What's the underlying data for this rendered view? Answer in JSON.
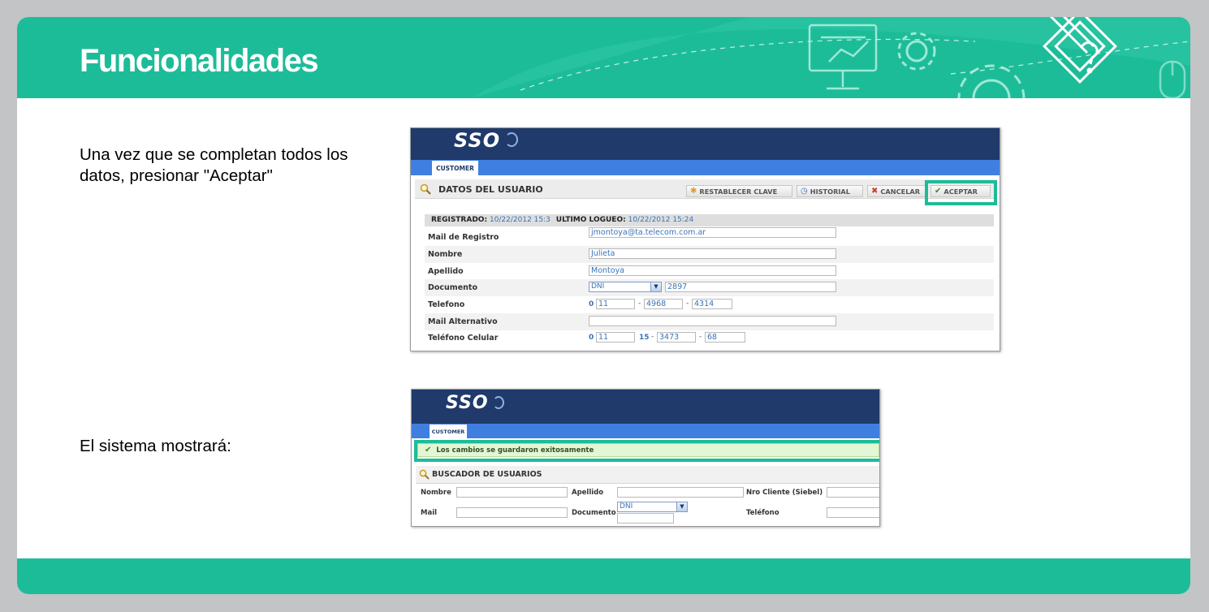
{
  "slide": {
    "title": "Funcionalidades",
    "instruction_1": "Una vez que se completan todos los datos, presionar \"Aceptar\"",
    "instruction_2": "El sistema mostrará:"
  },
  "colors": {
    "teal": "#1dbc99",
    "navy": "#1f3a6b",
    "blue": "#3f7fe0",
    "link": "#3a73b8"
  },
  "header_icons": [
    "presentation-board-icon",
    "gear-icon",
    "pencil-question-diamond-icon",
    "mouse-icon"
  ],
  "screen1": {
    "logo": "SSO",
    "tab": "CUSTOMER",
    "section_title": "DATOS DEL USUARIO",
    "buttons": {
      "restablecer": "RESTABLECER CLAVE",
      "historial": "HISTORIAL",
      "cancelar": "CANCELAR",
      "aceptar": "ACEPTAR"
    },
    "registrado_label": "REGISTRADO:",
    "registrado_value": "10/22/2012 15:3",
    "logueo_label": "ULTIMO LOGUEO:",
    "logueo_value": "10/22/2012 15:24",
    "fields": {
      "mail_registro": {
        "label": "Mail de Registro",
        "value": "jmontoya@ta.telecom.com.ar"
      },
      "nombre": {
        "label": "Nombre",
        "value": "Julieta"
      },
      "apellido": {
        "label": "Apellido",
        "value": "Montoya"
      },
      "documento": {
        "label": "Documento",
        "type": "DNI",
        "value": "2897"
      },
      "telefono": {
        "label": "Telefono",
        "prefix": "0",
        "area": "11",
        "part1": "4968",
        "part2": "4314"
      },
      "mail_alternativo": {
        "label": "Mail Alternativo",
        "value": ""
      },
      "celular": {
        "label": "Teléfono Celular",
        "prefix": "0",
        "area": "11",
        "mid": "15",
        "part1": "3473",
        "part2": "68"
      }
    }
  },
  "screen2": {
    "logo": "SSO",
    "tab": "CUSTOMER",
    "success_message": "Los cambios se guardaron exitosamente",
    "section_title": "BUSCADOR DE USUARIOS",
    "labels": {
      "nombre": "Nombre",
      "apellido": "Apellido",
      "nro_cliente": "Nro Cliente (Siebel)",
      "mail": "Mail",
      "documento": "Documento",
      "telefono": "Teléfono"
    },
    "documento_type": "DNI"
  }
}
